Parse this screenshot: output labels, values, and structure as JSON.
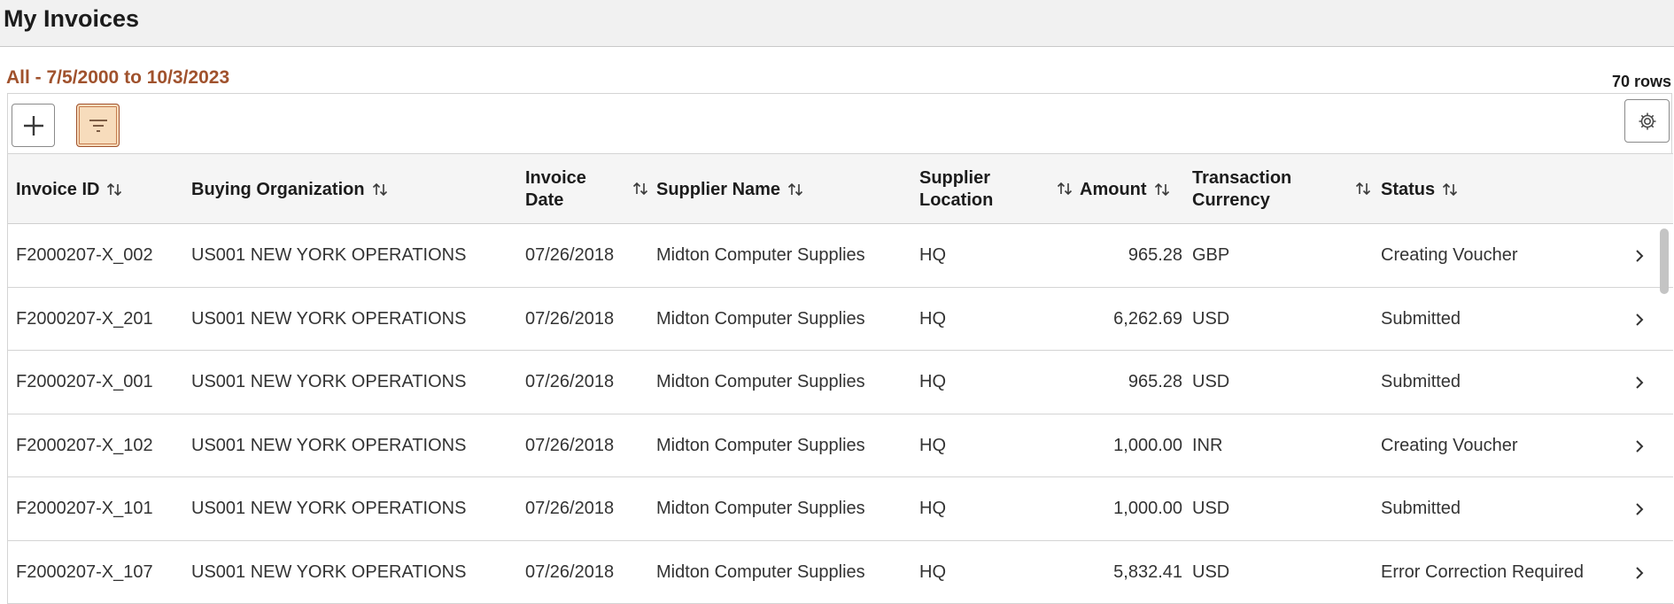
{
  "page": {
    "title": "My Invoices"
  },
  "grid": {
    "subtitle": "All - 7/5/2000 to 10/3/2023",
    "row_count": "70 rows",
    "toolbar": {
      "add_icon": "plus-icon",
      "filter_icon": "filter-icon",
      "settings_icon": "gear-icon"
    },
    "columns": {
      "invoice_id": "Invoice ID",
      "buying_org": "Buying Organization",
      "invoice_date_l1": "Invoice",
      "invoice_date_l2": "Date",
      "supplier_name": "Supplier Name",
      "supplier_loc_l1": "Supplier",
      "supplier_loc_l2": "Location",
      "amount": "Amount",
      "currency_l1": "Transaction",
      "currency_l2": "Currency",
      "status": "Status"
    },
    "rows": [
      {
        "invoice_id": "F2000207-X_002",
        "buying_org": "US001 NEW YORK OPERATIONS",
        "invoice_date": "07/26/2018",
        "supplier_name": "Midton Computer Supplies",
        "supplier_location": "HQ",
        "amount": "965.28",
        "currency": "GBP",
        "status": "Creating Voucher"
      },
      {
        "invoice_id": "F2000207-X_201",
        "buying_org": "US001 NEW YORK OPERATIONS",
        "invoice_date": "07/26/2018",
        "supplier_name": "Midton Computer Supplies",
        "supplier_location": "HQ",
        "amount": "6,262.69",
        "currency": "USD",
        "status": "Submitted"
      },
      {
        "invoice_id": "F2000207-X_001",
        "buying_org": "US001 NEW YORK OPERATIONS",
        "invoice_date": "07/26/2018",
        "supplier_name": "Midton Computer Supplies",
        "supplier_location": "HQ",
        "amount": "965.28",
        "currency": "USD",
        "status": "Submitted"
      },
      {
        "invoice_id": "F2000207-X_102",
        "buying_org": "US001 NEW YORK OPERATIONS",
        "invoice_date": "07/26/2018",
        "supplier_name": "Midton Computer Supplies",
        "supplier_location": "HQ",
        "amount": "1,000.00",
        "currency": "INR",
        "status": "Creating Voucher"
      },
      {
        "invoice_id": "F2000207-X_101",
        "buying_org": "US001 NEW YORK OPERATIONS",
        "invoice_date": "07/26/2018",
        "supplier_name": "Midton Computer Supplies",
        "supplier_location": "HQ",
        "amount": "1,000.00",
        "currency": "USD",
        "status": "Submitted"
      },
      {
        "invoice_id": "F2000207-X_107",
        "buying_org": "US001 NEW YORK OPERATIONS",
        "invoice_date": "07/26/2018",
        "supplier_name": "Midton Computer Supplies",
        "supplier_location": "HQ",
        "amount": "5,832.41",
        "currency": "USD",
        "status": "Error Correction Required"
      }
    ]
  },
  "colors": {
    "accent": "#a0522d",
    "filter_active_bg": "#f7dcbc",
    "header_bg": "#f1f1f1"
  }
}
